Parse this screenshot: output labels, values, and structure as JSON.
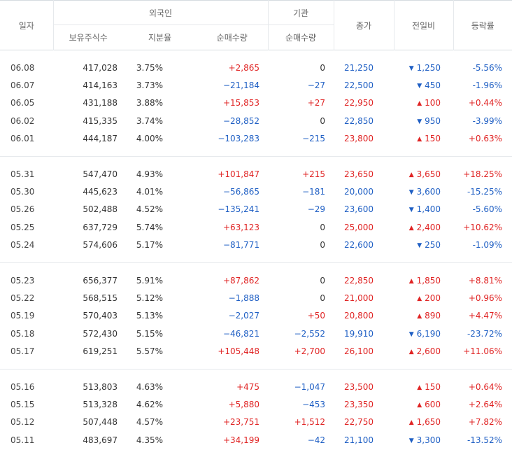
{
  "headers": {
    "date": "일자",
    "foreign": "외국인",
    "institution": "기관",
    "close": "종가",
    "change": "전일비",
    "rate": "등락률",
    "holdings": "보유주식수",
    "ratio": "지분율",
    "foreign_net": "순매수량",
    "inst_net": "순매수량"
  },
  "colors": {
    "up": "#e02424",
    "down": "#1f5fc4"
  },
  "groups": [
    {
      "rows": [
        {
          "date": "06.08",
          "holdings": "417,028",
          "ratio": "3.75%",
          "fnet": "+2,865",
          "inet": "0",
          "close": "21,250",
          "chg": "1,250",
          "dir": "down",
          "rate": "-5.56%"
        },
        {
          "date": "06.07",
          "holdings": "414,163",
          "ratio": "3.73%",
          "fnet": "−21,184",
          "inet": "−27",
          "close": "22,500",
          "chg": "450",
          "dir": "down",
          "rate": "-1.96%"
        },
        {
          "date": "06.05",
          "holdings": "431,188",
          "ratio": "3.88%",
          "fnet": "+15,853",
          "inet": "+27",
          "close": "22,950",
          "chg": "100",
          "dir": "up",
          "rate": "+0.44%"
        },
        {
          "date": "06.02",
          "holdings": "415,335",
          "ratio": "3.74%",
          "fnet": "−28,852",
          "inet": "0",
          "close": "22,850",
          "chg": "950",
          "dir": "down",
          "rate": "-3.99%"
        },
        {
          "date": "06.01",
          "holdings": "444,187",
          "ratio": "4.00%",
          "fnet": "−103,283",
          "inet": "−215",
          "close": "23,800",
          "chg": "150",
          "dir": "up",
          "rate": "+0.63%"
        }
      ]
    },
    {
      "rows": [
        {
          "date": "05.31",
          "holdings": "547,470",
          "ratio": "4.93%",
          "fnet": "+101,847",
          "inet": "+215",
          "close": "23,650",
          "chg": "3,650",
          "dir": "up",
          "rate": "+18.25%"
        },
        {
          "date": "05.30",
          "holdings": "445,623",
          "ratio": "4.01%",
          "fnet": "−56,865",
          "inet": "−181",
          "close": "20,000",
          "chg": "3,600",
          "dir": "down",
          "rate": "-15.25%"
        },
        {
          "date": "05.26",
          "holdings": "502,488",
          "ratio": "4.52%",
          "fnet": "−135,241",
          "inet": "−29",
          "close": "23,600",
          "chg": "1,400",
          "dir": "down",
          "rate": "-5.60%"
        },
        {
          "date": "05.25",
          "holdings": "637,729",
          "ratio": "5.74%",
          "fnet": "+63,123",
          "inet": "0",
          "close": "25,000",
          "chg": "2,400",
          "dir": "up",
          "rate": "+10.62%"
        },
        {
          "date": "05.24",
          "holdings": "574,606",
          "ratio": "5.17%",
          "fnet": "−81,771",
          "inet": "0",
          "close": "22,600",
          "chg": "250",
          "dir": "down",
          "rate": "-1.09%"
        }
      ]
    },
    {
      "rows": [
        {
          "date": "05.23",
          "holdings": "656,377",
          "ratio": "5.91%",
          "fnet": "+87,862",
          "inet": "0",
          "close": "22,850",
          "chg": "1,850",
          "dir": "up",
          "rate": "+8.81%"
        },
        {
          "date": "05.22",
          "holdings": "568,515",
          "ratio": "5.12%",
          "fnet": "−1,888",
          "inet": "0",
          "close": "21,000",
          "chg": "200",
          "dir": "up",
          "rate": "+0.96%"
        },
        {
          "date": "05.19",
          "holdings": "570,403",
          "ratio": "5.13%",
          "fnet": "−2,027",
          "inet": "+50",
          "close": "20,800",
          "chg": "890",
          "dir": "up",
          "rate": "+4.47%"
        },
        {
          "date": "05.18",
          "holdings": "572,430",
          "ratio": "5.15%",
          "fnet": "−46,821",
          "inet": "−2,552",
          "close": "19,910",
          "chg": "6,190",
          "dir": "down",
          "rate": "-23.72%"
        },
        {
          "date": "05.17",
          "holdings": "619,251",
          "ratio": "5.57%",
          "fnet": "+105,448",
          "inet": "+2,700",
          "close": "26,100",
          "chg": "2,600",
          "dir": "up",
          "rate": "+11.06%"
        }
      ]
    },
    {
      "rows": [
        {
          "date": "05.16",
          "holdings": "513,803",
          "ratio": "4.63%",
          "fnet": "+475",
          "inet": "−1,047",
          "close": "23,500",
          "chg": "150",
          "dir": "up",
          "rate": "+0.64%"
        },
        {
          "date": "05.15",
          "holdings": "513,328",
          "ratio": "4.62%",
          "fnet": "+5,880",
          "inet": "−453",
          "close": "23,350",
          "chg": "600",
          "dir": "up",
          "rate": "+2.64%"
        },
        {
          "date": "05.12",
          "holdings": "507,448",
          "ratio": "4.57%",
          "fnet": "+23,751",
          "inet": "+1,512",
          "close": "22,750",
          "chg": "1,650",
          "dir": "up",
          "rate": "+7.82%"
        },
        {
          "date": "05.11",
          "holdings": "483,697",
          "ratio": "4.35%",
          "fnet": "+34,199",
          "inet": "−42",
          "close": "21,100",
          "chg": "3,300",
          "dir": "down",
          "rate": "-13.52%"
        }
      ]
    }
  ]
}
